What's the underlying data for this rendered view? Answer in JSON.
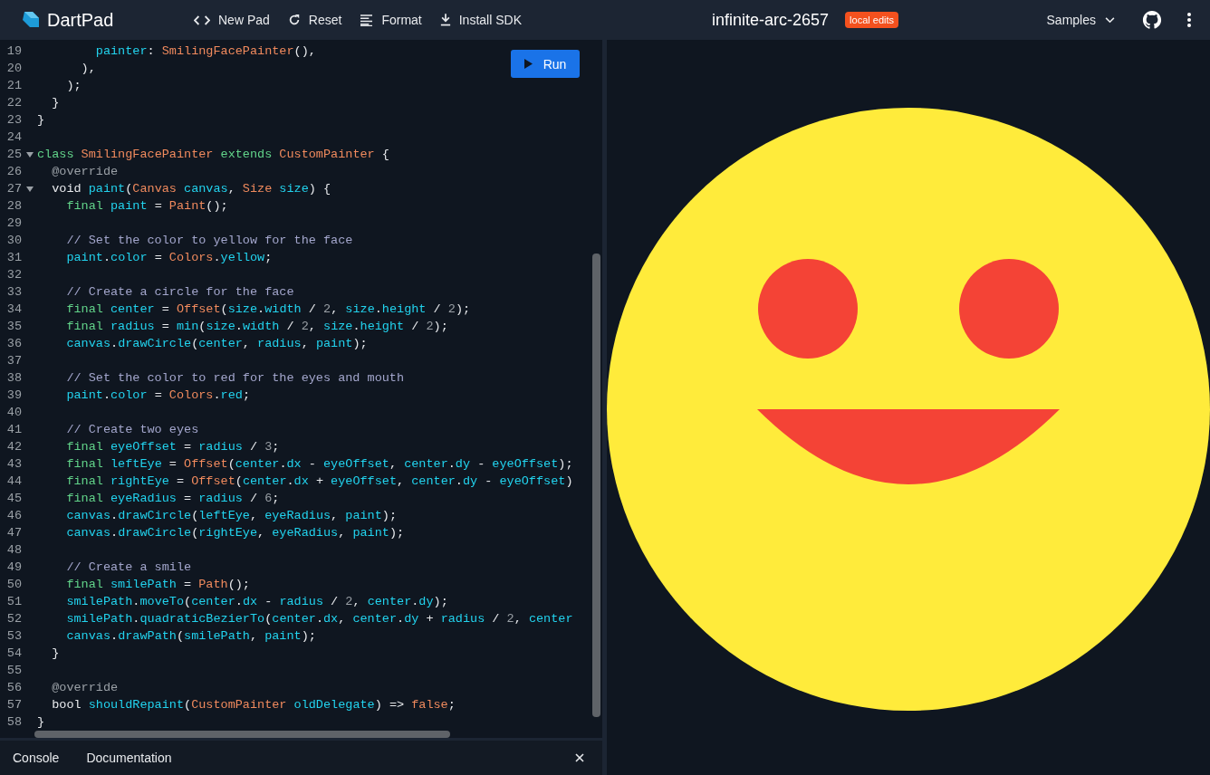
{
  "app": {
    "name": "DartPad"
  },
  "toolbar": [
    {
      "label": "New Pad",
      "kind": "code"
    },
    {
      "label": "Reset",
      "kind": "reset"
    },
    {
      "label": "Format",
      "kind": "format"
    },
    {
      "label": "Install SDK",
      "kind": "download"
    }
  ],
  "pad_title": "infinite-arc-2657",
  "badge": "local edits",
  "samples_menu": "Samples",
  "editor": {
    "run_button": "Run",
    "lines": [
      {
        "number": "19",
        "tokens": [
          {
            "kind": "identifier",
            "text": "        painter"
          },
          {
            "kind": "punct",
            "text": ": "
          },
          {
            "kind": "type",
            "text": "SmilingFacePainter"
          },
          {
            "kind": "punct",
            "text": "(),"
          }
        ]
      },
      {
        "number": "20",
        "tokens": [
          {
            "kind": "punct",
            "text": "      ),"
          }
        ]
      },
      {
        "number": "21",
        "tokens": [
          {
            "kind": "punct",
            "text": "    );"
          }
        ]
      },
      {
        "number": "22",
        "tokens": [
          {
            "kind": "punct",
            "text": "  }"
          }
        ]
      },
      {
        "number": "23",
        "tokens": [
          {
            "kind": "punct",
            "text": "}"
          }
        ]
      },
      {
        "number": "24"
      },
      {
        "number": "25",
        "expanded": true,
        "tokens": [
          {
            "kind": "keyword",
            "text": "class"
          },
          {
            "kind": "type",
            "text": " SmilingFacePainter"
          },
          {
            "kind": "keyword",
            "text": " extends"
          },
          {
            "kind": "type",
            "text": " CustomPainter"
          },
          {
            "kind": "punct",
            "text": " {"
          }
        ]
      },
      {
        "number": "26",
        "tokens": [
          {
            "kind": "annotation",
            "text": "  @override"
          }
        ]
      },
      {
        "number": "27",
        "expanded": true,
        "tokens": [
          {
            "kind": "punct",
            "text": "  void"
          },
          {
            "kind": "identifier",
            "text": " paint"
          },
          {
            "kind": "punct",
            "text": "("
          },
          {
            "kind": "type",
            "text": "Canvas"
          },
          {
            "kind": "identifier",
            "text": " canvas"
          },
          {
            "kind": "punct",
            "text": ", "
          },
          {
            "kind": "type",
            "text": "Size"
          },
          {
            "kind": "identifier",
            "text": " size"
          },
          {
            "kind": "punct",
            "text": ") {"
          }
        ]
      },
      {
        "number": "28",
        "tokens": [
          {
            "kind": "keyword",
            "text": "    final"
          },
          {
            "kind": "identifier",
            "text": " paint"
          },
          {
            "kind": "punct",
            "text": " = "
          },
          {
            "kind": "type",
            "text": "Paint"
          },
          {
            "kind": "punct",
            "text": "();"
          }
        ]
      },
      {
        "number": "29"
      },
      {
        "number": "30",
        "tokens": [
          {
            "kind": "comment",
            "text": "    // Set the color to yellow for the face"
          }
        ]
      },
      {
        "number": "31",
        "tokens": [
          {
            "kind": "identifier",
            "text": "    paint"
          },
          {
            "kind": "punct",
            "text": "."
          },
          {
            "kind": "identifier",
            "text": "color"
          },
          {
            "kind": "punct",
            "text": " = "
          },
          {
            "kind": "type",
            "text": "Colors"
          },
          {
            "kind": "punct",
            "text": "."
          },
          {
            "kind": "identifier",
            "text": "yellow"
          },
          {
            "kind": "punct",
            "text": ";"
          }
        ]
      },
      {
        "number": "32"
      },
      {
        "number": "33",
        "tokens": [
          {
            "kind": "comment",
            "text": "    // Create a circle for the face"
          }
        ]
      },
      {
        "number": "34",
        "tokens": [
          {
            "kind": "keyword",
            "text": "    final"
          },
          {
            "kind": "identifier",
            "text": " center"
          },
          {
            "kind": "punct",
            "text": " = "
          },
          {
            "kind": "type",
            "text": "Offset"
          },
          {
            "kind": "punct",
            "text": "("
          },
          {
            "kind": "identifier",
            "text": "size"
          },
          {
            "kind": "punct",
            "text": "."
          },
          {
            "kind": "identifier",
            "text": "width"
          },
          {
            "kind": "punct",
            "text": " / "
          },
          {
            "kind": "number",
            "text": "2"
          },
          {
            "kind": "punct",
            "text": ", "
          },
          {
            "kind": "identifier",
            "text": "size"
          },
          {
            "kind": "punct",
            "text": "."
          },
          {
            "kind": "identifier",
            "text": "height"
          },
          {
            "kind": "punct",
            "text": " / "
          },
          {
            "kind": "number",
            "text": "2"
          },
          {
            "kind": "punct",
            "text": ");"
          }
        ]
      },
      {
        "number": "35",
        "tokens": [
          {
            "kind": "keyword",
            "text": "    final"
          },
          {
            "kind": "identifier",
            "text": " radius"
          },
          {
            "kind": "punct",
            "text": " = "
          },
          {
            "kind": "identifier",
            "text": "min"
          },
          {
            "kind": "punct",
            "text": "("
          },
          {
            "kind": "identifier",
            "text": "size"
          },
          {
            "kind": "punct",
            "text": "."
          },
          {
            "kind": "identifier",
            "text": "width"
          },
          {
            "kind": "punct",
            "text": " / "
          },
          {
            "kind": "number",
            "text": "2"
          },
          {
            "kind": "punct",
            "text": ", "
          },
          {
            "kind": "identifier",
            "text": "size"
          },
          {
            "kind": "punct",
            "text": "."
          },
          {
            "kind": "identifier",
            "text": "height"
          },
          {
            "kind": "punct",
            "text": " / "
          },
          {
            "kind": "number",
            "text": "2"
          },
          {
            "kind": "punct",
            "text": ");"
          }
        ]
      },
      {
        "number": "36",
        "tokens": [
          {
            "kind": "identifier",
            "text": "    canvas"
          },
          {
            "kind": "punct",
            "text": "."
          },
          {
            "kind": "identifier",
            "text": "drawCircle"
          },
          {
            "kind": "punct",
            "text": "("
          },
          {
            "kind": "identifier",
            "text": "center"
          },
          {
            "kind": "punct",
            "text": ", "
          },
          {
            "kind": "identifier",
            "text": "radius"
          },
          {
            "kind": "punct",
            "text": ", "
          },
          {
            "kind": "identifier",
            "text": "paint"
          },
          {
            "kind": "punct",
            "text": ");"
          }
        ]
      },
      {
        "number": "37"
      },
      {
        "number": "38",
        "tokens": [
          {
            "kind": "comment",
            "text": "    // Set the color to red for the eyes and mouth"
          }
        ]
      },
      {
        "number": "39",
        "tokens": [
          {
            "kind": "identifier",
            "text": "    paint"
          },
          {
            "kind": "punct",
            "text": "."
          },
          {
            "kind": "identifier",
            "text": "color"
          },
          {
            "kind": "punct",
            "text": " = "
          },
          {
            "kind": "type",
            "text": "Colors"
          },
          {
            "kind": "punct",
            "text": "."
          },
          {
            "kind": "identifier",
            "text": "red"
          },
          {
            "kind": "punct",
            "text": ";"
          }
        ]
      },
      {
        "number": "40"
      },
      {
        "number": "41",
        "tokens": [
          {
            "kind": "comment",
            "text": "    // Create two eyes"
          }
        ]
      },
      {
        "number": "42",
        "tokens": [
          {
            "kind": "keyword",
            "text": "    final"
          },
          {
            "kind": "identifier",
            "text": " eyeOffset"
          },
          {
            "kind": "punct",
            "text": " = "
          },
          {
            "kind": "identifier",
            "text": "radius"
          },
          {
            "kind": "punct",
            "text": " / "
          },
          {
            "kind": "number",
            "text": "3"
          },
          {
            "kind": "punct",
            "text": ";"
          }
        ]
      },
      {
        "number": "43",
        "tokens": [
          {
            "kind": "keyword",
            "text": "    final"
          },
          {
            "kind": "identifier",
            "text": " leftEye"
          },
          {
            "kind": "punct",
            "text": " = "
          },
          {
            "kind": "type",
            "text": "Offset"
          },
          {
            "kind": "punct",
            "text": "("
          },
          {
            "kind": "identifier",
            "text": "center"
          },
          {
            "kind": "punct",
            "text": "."
          },
          {
            "kind": "identifier",
            "text": "dx"
          },
          {
            "kind": "punct",
            "text": " - "
          },
          {
            "kind": "identifier",
            "text": "eyeOffset"
          },
          {
            "kind": "punct",
            "text": ", "
          },
          {
            "kind": "identifier",
            "text": "center"
          },
          {
            "kind": "punct",
            "text": "."
          },
          {
            "kind": "identifier",
            "text": "dy"
          },
          {
            "kind": "punct",
            "text": " - "
          },
          {
            "kind": "identifier",
            "text": "eyeOffset"
          },
          {
            "kind": "punct",
            "text": ");"
          }
        ]
      },
      {
        "number": "44",
        "tokens": [
          {
            "kind": "keyword",
            "text": "    final"
          },
          {
            "kind": "identifier",
            "text": " rightEye"
          },
          {
            "kind": "punct",
            "text": " = "
          },
          {
            "kind": "type",
            "text": "Offset"
          },
          {
            "kind": "punct",
            "text": "("
          },
          {
            "kind": "identifier",
            "text": "center"
          },
          {
            "kind": "punct",
            "text": "."
          },
          {
            "kind": "identifier",
            "text": "dx"
          },
          {
            "kind": "punct",
            "text": " + "
          },
          {
            "kind": "identifier",
            "text": "eyeOffset"
          },
          {
            "kind": "punct",
            "text": ", "
          },
          {
            "kind": "identifier",
            "text": "center"
          },
          {
            "kind": "punct",
            "text": "."
          },
          {
            "kind": "identifier",
            "text": "dy"
          },
          {
            "kind": "punct",
            "text": " - "
          },
          {
            "kind": "identifier",
            "text": "eyeOffset"
          },
          {
            "kind": "punct",
            "text": ")"
          }
        ]
      },
      {
        "number": "45",
        "tokens": [
          {
            "kind": "keyword",
            "text": "    final"
          },
          {
            "kind": "identifier",
            "text": " eyeRadius"
          },
          {
            "kind": "punct",
            "text": " = "
          },
          {
            "kind": "identifier",
            "text": "radius"
          },
          {
            "kind": "punct",
            "text": " / "
          },
          {
            "kind": "number",
            "text": "6"
          },
          {
            "kind": "punct",
            "text": ";"
          }
        ]
      },
      {
        "number": "46",
        "tokens": [
          {
            "kind": "identifier",
            "text": "    canvas"
          },
          {
            "kind": "punct",
            "text": "."
          },
          {
            "kind": "identifier",
            "text": "drawCircle"
          },
          {
            "kind": "punct",
            "text": "("
          },
          {
            "kind": "identifier",
            "text": "leftEye"
          },
          {
            "kind": "punct",
            "text": ", "
          },
          {
            "kind": "identifier",
            "text": "eyeRadius"
          },
          {
            "kind": "punct",
            "text": ", "
          },
          {
            "kind": "identifier",
            "text": "paint"
          },
          {
            "kind": "punct",
            "text": ");"
          }
        ]
      },
      {
        "number": "47",
        "tokens": [
          {
            "kind": "identifier",
            "text": "    canvas"
          },
          {
            "kind": "punct",
            "text": "."
          },
          {
            "kind": "identifier",
            "text": "drawCircle"
          },
          {
            "kind": "punct",
            "text": "("
          },
          {
            "kind": "identifier",
            "text": "rightEye"
          },
          {
            "kind": "punct",
            "text": ", "
          },
          {
            "kind": "identifier",
            "text": "eyeRadius"
          },
          {
            "kind": "punct",
            "text": ", "
          },
          {
            "kind": "identifier",
            "text": "paint"
          },
          {
            "kind": "punct",
            "text": ");"
          }
        ]
      },
      {
        "number": "48"
      },
      {
        "number": "49",
        "tokens": [
          {
            "kind": "comment",
            "text": "    // Create a smile"
          }
        ]
      },
      {
        "number": "50",
        "tokens": [
          {
            "kind": "keyword",
            "text": "    final"
          },
          {
            "kind": "identifier",
            "text": " smilePath"
          },
          {
            "kind": "punct",
            "text": " = "
          },
          {
            "kind": "type",
            "text": "Path"
          },
          {
            "kind": "punct",
            "text": "();"
          }
        ]
      },
      {
        "number": "51",
        "tokens": [
          {
            "kind": "identifier",
            "text": "    smilePath"
          },
          {
            "kind": "punct",
            "text": "."
          },
          {
            "kind": "identifier",
            "text": "moveTo"
          },
          {
            "kind": "punct",
            "text": "("
          },
          {
            "kind": "identifier",
            "text": "center"
          },
          {
            "kind": "punct",
            "text": "."
          },
          {
            "kind": "identifier",
            "text": "dx"
          },
          {
            "kind": "punct",
            "text": " - "
          },
          {
            "kind": "identifier",
            "text": "radius"
          },
          {
            "kind": "punct",
            "text": " / "
          },
          {
            "kind": "number",
            "text": "2"
          },
          {
            "kind": "punct",
            "text": ", "
          },
          {
            "kind": "identifier",
            "text": "center"
          },
          {
            "kind": "punct",
            "text": "."
          },
          {
            "kind": "identifier",
            "text": "dy"
          },
          {
            "kind": "punct",
            "text": ");"
          }
        ]
      },
      {
        "number": "52",
        "tokens": [
          {
            "kind": "identifier",
            "text": "    smilePath"
          },
          {
            "kind": "punct",
            "text": "."
          },
          {
            "kind": "identifier",
            "text": "quadraticBezierTo"
          },
          {
            "kind": "punct",
            "text": "("
          },
          {
            "kind": "identifier",
            "text": "center"
          },
          {
            "kind": "punct",
            "text": "."
          },
          {
            "kind": "identifier",
            "text": "dx"
          },
          {
            "kind": "punct",
            "text": ", "
          },
          {
            "kind": "identifier",
            "text": "center"
          },
          {
            "kind": "punct",
            "text": "."
          },
          {
            "kind": "identifier",
            "text": "dy"
          },
          {
            "kind": "punct",
            "text": " + "
          },
          {
            "kind": "identifier",
            "text": "radius"
          },
          {
            "kind": "punct",
            "text": " / "
          },
          {
            "kind": "number",
            "text": "2"
          },
          {
            "kind": "punct",
            "text": ", "
          },
          {
            "kind": "identifier",
            "text": "center"
          }
        ]
      },
      {
        "number": "53",
        "tokens": [
          {
            "kind": "identifier",
            "text": "    canvas"
          },
          {
            "kind": "punct",
            "text": "."
          },
          {
            "kind": "identifier",
            "text": "drawPath"
          },
          {
            "kind": "punct",
            "text": "("
          },
          {
            "kind": "identifier",
            "text": "smilePath"
          },
          {
            "kind": "punct",
            "text": ", "
          },
          {
            "kind": "identifier",
            "text": "paint"
          },
          {
            "kind": "punct",
            "text": ");"
          }
        ]
      },
      {
        "number": "54",
        "tokens": [
          {
            "kind": "punct",
            "text": "  }"
          }
        ]
      },
      {
        "number": "55"
      },
      {
        "number": "56",
        "tokens": [
          {
            "kind": "annotation",
            "text": "  @override"
          }
        ]
      },
      {
        "number": "57",
        "tokens": [
          {
            "kind": "punct",
            "text": "  bool"
          },
          {
            "kind": "identifier",
            "text": " shouldRepaint"
          },
          {
            "kind": "punct",
            "text": "("
          },
          {
            "kind": "type",
            "text": "CustomPainter"
          },
          {
            "kind": "identifier",
            "text": " oldDelegate"
          },
          {
            "kind": "punct",
            "text": ") => "
          },
          {
            "kind": "type",
            "text": "false"
          },
          {
            "kind": "punct",
            "text": ";"
          }
        ]
      },
      {
        "number": "58",
        "tokens": [
          {
            "kind": "punct",
            "text": "}"
          }
        ]
      }
    ]
  },
  "bottom_panel": {
    "tabs": [
      "Console",
      "Documentation"
    ]
  }
}
